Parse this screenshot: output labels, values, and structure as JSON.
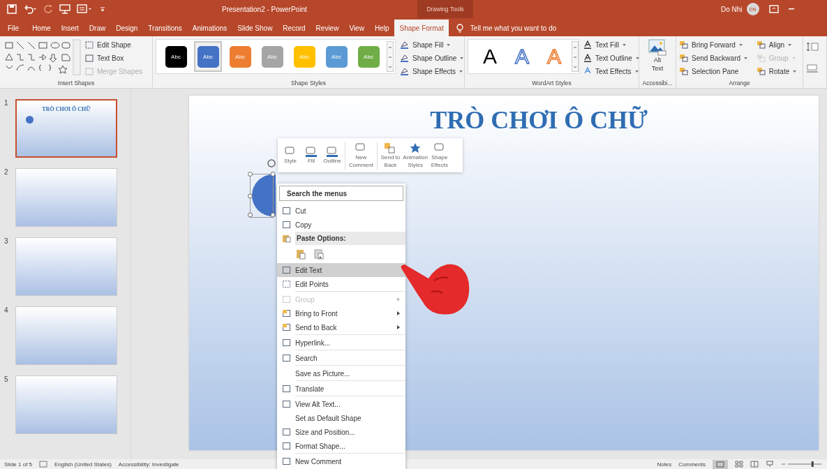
{
  "window": {
    "title": "Presentation2  -  PowerPoint",
    "context_label": "Drawing Tools",
    "user": "Do Nhi",
    "avatar": "DN"
  },
  "tabs": [
    {
      "label": "File",
      "selected": false
    },
    {
      "label": "Home",
      "selected": false
    },
    {
      "label": "Insert",
      "selected": false
    },
    {
      "label": "Draw",
      "selected": false
    },
    {
      "label": "Design",
      "selected": false
    },
    {
      "label": "Transitions",
      "selected": false
    },
    {
      "label": "Animations",
      "selected": false
    },
    {
      "label": "Slide Show",
      "selected": false
    },
    {
      "label": "Record",
      "selected": false
    },
    {
      "label": "Review",
      "selected": false
    },
    {
      "label": "View",
      "selected": false
    },
    {
      "label": "Help",
      "selected": false
    },
    {
      "label": "Shape Format",
      "selected": true
    }
  ],
  "tell_me": {
    "placeholder": "Tell me what you want to do"
  },
  "ribbon": {
    "insert_shapes": {
      "label": "Insert Shapes",
      "commands": [
        {
          "label": "Edit Shape",
          "disabled": false
        },
        {
          "label": "Text Box",
          "disabled": false
        },
        {
          "label": "Merge Shapes",
          "disabled": true
        }
      ]
    },
    "shape_styles": {
      "label": "Shape Styles",
      "swatches": [
        {
          "text": "Abc",
          "color": "#000000",
          "selected": false
        },
        {
          "text": "Abc",
          "color": "#4472c4",
          "selected": true
        },
        {
          "text": "Abc",
          "color": "#ed7d31",
          "selected": false
        },
        {
          "text": "Abc",
          "color": "#a5a5a5",
          "selected": false
        },
        {
          "text": "Abc",
          "color": "#ffc000",
          "selected": false
        },
        {
          "text": "Abc",
          "color": "#5b9bd5",
          "selected": false
        },
        {
          "text": "Abc",
          "color": "#70ad47",
          "selected": false
        }
      ],
      "commands": [
        "Shape Fill",
        "Shape Outline",
        "Shape Effects"
      ]
    },
    "wordart": {
      "label": "WordArt Styles",
      "samples": [
        {
          "text": "A",
          "kind": "black"
        },
        {
          "text": "A",
          "kind": "blue-outline"
        },
        {
          "text": "A",
          "kind": "orange-outline"
        }
      ],
      "commands": [
        "Text Fill",
        "Text Outline",
        "Text Effects"
      ]
    },
    "accessibility": {
      "label": "Accessibi...",
      "button": "Alt\nText"
    },
    "arrange": {
      "label": "Arrange",
      "commands": [
        {
          "label": "Bring Forward",
          "disabled": false
        },
        {
          "label": "Send Backward",
          "disabled": false
        },
        {
          "label": "Selection Pane",
          "disabled": false
        },
        {
          "label": "Align",
          "disabled": false
        },
        {
          "label": "Group",
          "disabled": true
        },
        {
          "label": "Rotate",
          "disabled": false
        }
      ]
    }
  },
  "slides": [
    {
      "number": "1",
      "selected": true,
      "title": "TRÒ CHƠI Ô CHỮ"
    },
    {
      "number": "2",
      "selected": false
    },
    {
      "number": "3",
      "selected": false
    },
    {
      "number": "4",
      "selected": false
    },
    {
      "number": "5",
      "selected": false
    }
  ],
  "slide": {
    "title": "TRÒ CHƠI Ô CHỮ"
  },
  "mini_toolbar": [
    "Style",
    "Fill",
    "Outline",
    "New\nComment",
    "Send to\nBack",
    "Animation\nStyles",
    "Shape\nEffects"
  ],
  "context_menu": {
    "search": {
      "placeholder": "Search the menus"
    },
    "items": [
      {
        "kind": "item",
        "label": "Cut",
        "disabled": false,
        "selected": false,
        "submenu": false,
        "separator_before": false
      },
      {
        "kind": "item",
        "label": "Copy",
        "disabled": false,
        "selected": false,
        "submenu": false,
        "separator_before": false
      },
      {
        "kind": "header",
        "label": "Paste Options:"
      },
      {
        "kind": "paste-icons"
      },
      {
        "kind": "item",
        "label": "Edit Text",
        "disabled": false,
        "selected": true,
        "submenu": false,
        "separator_before": false
      },
      {
        "kind": "item",
        "label": "Edit Points",
        "disabled": false,
        "selected": false,
        "submenu": false,
        "separator_before": false
      },
      {
        "kind": "item",
        "label": "Group",
        "disabled": true,
        "selected": false,
        "submenu": true,
        "separator_before": true
      },
      {
        "kind": "item",
        "label": "Bring to Front",
        "disabled": false,
        "selected": false,
        "submenu": true,
        "separator_before": false
      },
      {
        "kind": "item",
        "label": "Send to Back",
        "disabled": false,
        "selected": false,
        "submenu": true,
        "separator_before": false
      },
      {
        "kind": "item",
        "label": "Hyperlink...",
        "disabled": false,
        "selected": false,
        "submenu": false,
        "separator_before": true
      },
      {
        "kind": "item",
        "label": "Search",
        "disabled": false,
        "selected": false,
        "submenu": false,
        "separator_before": true
      },
      {
        "kind": "item",
        "label": "Save as Picture...",
        "disabled": false,
        "selected": false,
        "submenu": false,
        "separator_before": true
      },
      {
        "kind": "item",
        "label": "Translate",
        "disabled": false,
        "selected": false,
        "submenu": false,
        "separator_before": true
      },
      {
        "kind": "item",
        "label": "View Alt Text...",
        "disabled": false,
        "selected": false,
        "submenu": false,
        "separator_before": true
      },
      {
        "kind": "item",
        "label": "Set as Default Shape",
        "disabled": false,
        "selected": false,
        "submenu": false,
        "separator_before": false
      },
      {
        "kind": "item",
        "label": "Size and Position...",
        "disabled": false,
        "selected": false,
        "submenu": false,
        "separator_before": false
      },
      {
        "kind": "item",
        "label": "Format Shape...",
        "disabled": false,
        "selected": false,
        "submenu": false,
        "separator_before": false
      },
      {
        "kind": "item",
        "label": "New Comment",
        "disabled": false,
        "selected": false,
        "submenu": false,
        "separator_before": true
      }
    ]
  },
  "status_bar": {
    "slide": "Slide 1 of 5",
    "language": "English (United States)",
    "accessibility": "Accessibility: Investigate",
    "notes": "Notes",
    "comments": "Comments",
    "zoom": {
      "level": 0.75
    }
  }
}
